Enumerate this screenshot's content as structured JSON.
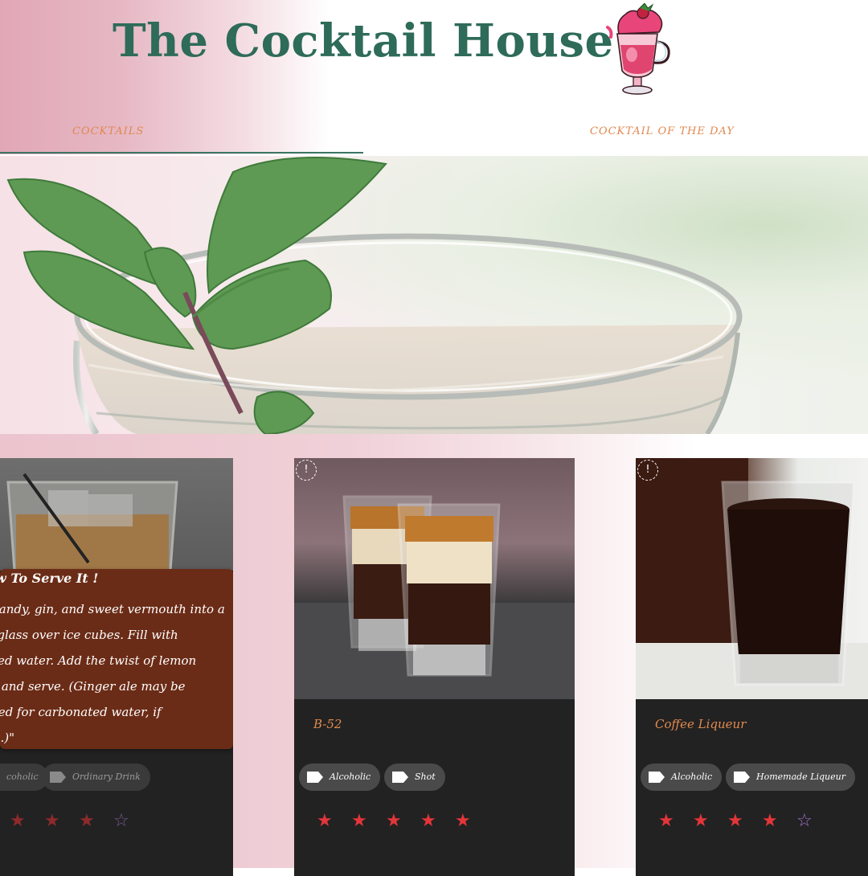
{
  "site": {
    "title": "The Cocktail House",
    "logo_icon": "cocktail-glass-logo"
  },
  "nav": {
    "items": [
      {
        "label": "COCKTAILS"
      },
      {
        "label": "COCKTAIL OF THE DAY"
      }
    ]
  },
  "hero": {
    "image": "mint-julep-glass-photo"
  },
  "cards": [
    {
      "name": "",
      "image": "brandy-cocktail-on-ice-photo",
      "overlay": {
        "heading": "w To Serve It !",
        "lines": [
          "brandy, gin, and sweet vermouth into a",
          "ll glass over ice cubes. Fill with",
          "ated water. Add the twist of lemon",
          "ir, and serve. (Ginger ale may be",
          "uted for carbonated water, if",
          "ed.)\""
        ]
      },
      "tags": [
        "coholic",
        "Ordinary Drink"
      ],
      "rating": 4
    },
    {
      "name": "B-52",
      "image": "b52-layered-shots-photo",
      "info_icon": "!",
      "tags": [
        "Alcoholic",
        "Shot"
      ],
      "rating": 5
    },
    {
      "name": "Coffee Liqueur",
      "image": "coffee-liqueur-shot-photo",
      "info_icon": "!",
      "tags": [
        "Alcoholic",
        "Homemade Liqueur"
      ],
      "rating": 4
    }
  ],
  "colors": {
    "title": "#2e6b59",
    "nav": "#e0884f",
    "card_bg": "#222222",
    "card_name": "#e28a4e",
    "star_on": "#e4353a",
    "star_off": "#a875d4",
    "overlay_bg": "#6b2c17"
  }
}
